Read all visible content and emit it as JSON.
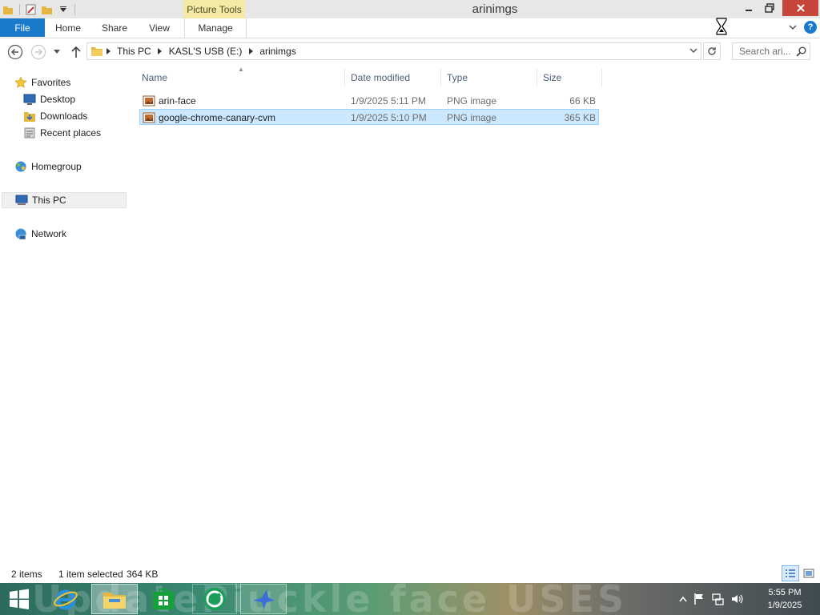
{
  "window": {
    "title": "arinimgs",
    "contextual_tab_group": "Picture Tools"
  },
  "ribbon": {
    "file_label": "File",
    "tabs": [
      "Home",
      "Share",
      "View",
      "Manage"
    ]
  },
  "address": {
    "crumbs": [
      "This PC",
      "KASL'S USB (E:)",
      "arinimgs"
    ],
    "search_placeholder": "Search ari..."
  },
  "navpane": {
    "favorites": "Favorites",
    "desktop": "Desktop",
    "downloads": "Downloads",
    "recent_places": "Recent places",
    "homegroup": "Homegroup",
    "this_pc": "This PC",
    "network": "Network"
  },
  "columns": {
    "name": "Name",
    "date_modified": "Date modified",
    "type": "Type",
    "size": "Size"
  },
  "files": [
    {
      "name": "arin-face",
      "date": "1/9/2025 5:11 PM",
      "type": "PNG image",
      "size": "66 KB",
      "selected": false
    },
    {
      "name": "google-chrome-canary-cvm",
      "date": "1/9/2025 5:10 PM",
      "type": "PNG image",
      "size": "365 KB",
      "selected": true
    }
  ],
  "status": {
    "item_count": "2 items",
    "selected": "1 item selected",
    "selected_size": "364 KB"
  },
  "wallpaper": {
    "text": "UpdatePiuckle face   USES"
  },
  "clock": {
    "time": "5:55 PM",
    "date": "1/9/2025"
  },
  "colors": {
    "file_tab": "#1979ca",
    "picture_tools": "#f5eaa3",
    "close": "#c7463b",
    "selection": "#cce8ff",
    "header_text": "#4c607a"
  },
  "icons": {
    "quick_access": [
      "properties-icon",
      "new-folder-icon",
      "customize-qat-icon"
    ],
    "nav": [
      "back-arrow-icon",
      "forward-arrow-icon",
      "up-arrow-icon",
      "refresh-icon",
      "search-icon"
    ],
    "tray": [
      "show-hidden-icons",
      "action-center-flag-icon",
      "network-icon",
      "volume-icon"
    ]
  }
}
